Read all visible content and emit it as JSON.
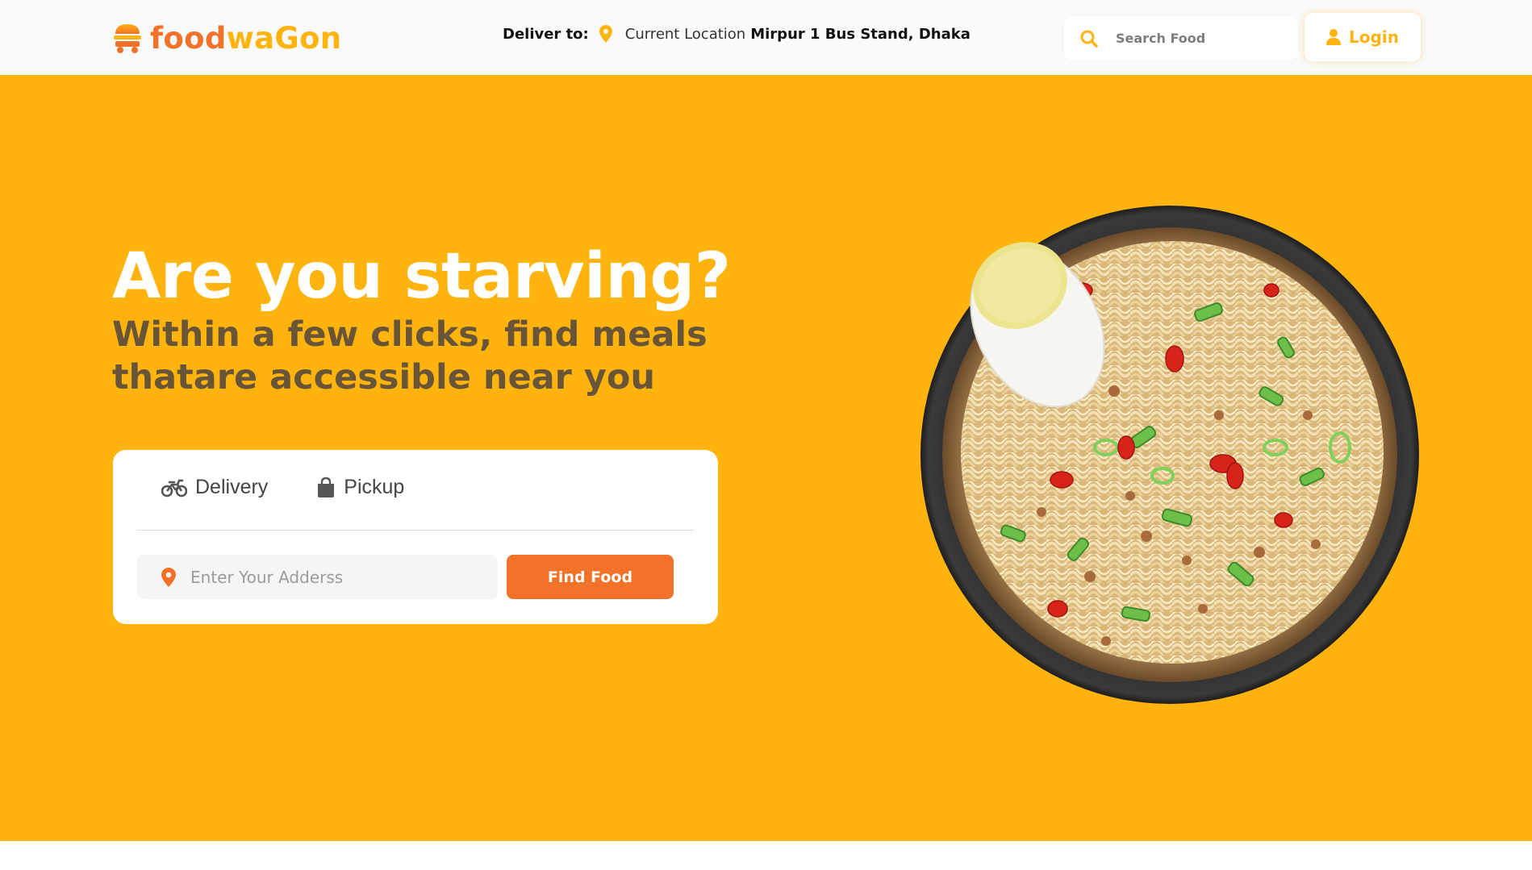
{
  "brand": {
    "name_part1": "food",
    "name_part2": "waGon"
  },
  "deliver": {
    "label": "Deliver to:",
    "current_label": "Current Location",
    "address": "Mirpur 1 Bus Stand, Dhaka"
  },
  "search": {
    "placeholder": "Search Food"
  },
  "login": {
    "label": "Login"
  },
  "hero": {
    "title": "Are you starving?",
    "subtitle": "Within a few clicks, find meals thatare accessible near you"
  },
  "order_card": {
    "tabs": [
      {
        "label": "Delivery",
        "icon": "motorcycle-icon"
      },
      {
        "label": "Pickup",
        "icon": "shopping-bag-icon"
      }
    ],
    "address_placeholder": "Enter Your Adderss",
    "find_button": "Find Food"
  },
  "colors": {
    "primary_orange": "#f17228",
    "accent_yellow": "#ffb30e",
    "navbar_bg": "#f9fafb"
  }
}
